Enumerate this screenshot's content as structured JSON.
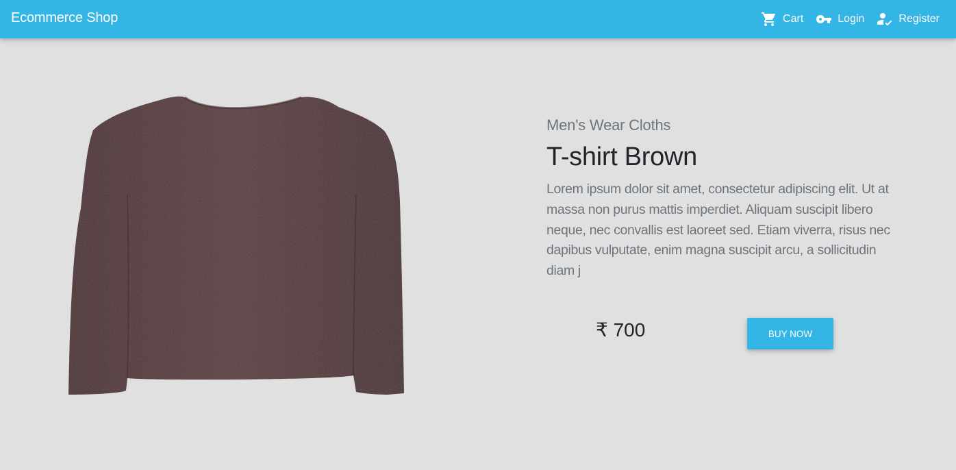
{
  "navbar": {
    "brand": "Ecommerce Shop",
    "links": [
      {
        "label": "Cart",
        "icon": "cart-icon"
      },
      {
        "label": "Login",
        "icon": "key-icon"
      },
      {
        "label": "Register",
        "icon": "person-check-icon"
      }
    ]
  },
  "product": {
    "image_alt": "Brown long sleeve t-shirt",
    "category": "Men's Wear Cloths",
    "title": "T-shirt Brown",
    "description": "Lorem ipsum dolor sit amet, consectetur adipiscing elit. Ut at massa non purus mattis imperdiet. Aliquam suscipit libero neque, nec convallis est laoreet sed. Etiam viverra, risus nec dapibus vulputate, enim magna suscipit arcu, a sollicitudin diam j",
    "price": "₹ 700",
    "buy_label": "Buy Now"
  },
  "colors": {
    "primary": "#33b5e5",
    "background": "#e0e0e0",
    "shirt": "#5a3a3c"
  }
}
